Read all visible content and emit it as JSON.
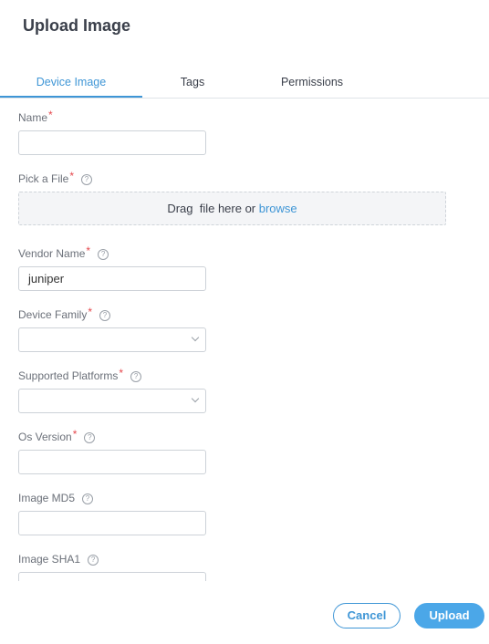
{
  "dialog": {
    "title": "Upload Image"
  },
  "tabs": [
    {
      "label": "Device Image",
      "active": true
    },
    {
      "label": "Tags",
      "active": false
    },
    {
      "label": "Permissions",
      "active": false
    }
  ],
  "fields": {
    "name": {
      "label": "Name",
      "required_mark": "*",
      "value": ""
    },
    "file": {
      "label": "Pick a File",
      "required_mark": "*",
      "help": "?",
      "drop_text": "Drag  file here or ",
      "browse_link": "browse"
    },
    "vendor": {
      "label": "Vendor Name",
      "required_mark": "*",
      "help": "?",
      "value": "juniper"
    },
    "device_family": {
      "label": "Device Family",
      "required_mark": "*",
      "help": "?",
      "value": ""
    },
    "supported_platforms": {
      "label": "Supported Platforms",
      "required_mark": "*",
      "help": "?",
      "value": ""
    },
    "os_version": {
      "label": "Os Version",
      "required_mark": "*",
      "help": "?",
      "value": ""
    },
    "image_md5": {
      "label": "Image MD5",
      "help": "?",
      "value": ""
    },
    "image_sha1": {
      "label": "Image SHA1",
      "help": "?",
      "value": ""
    }
  },
  "buttons": {
    "cancel": "Cancel",
    "upload": "Upload"
  },
  "colors": {
    "accent": "#3f96d6",
    "primary_button": "#4ba7e8",
    "required": "#e5484d"
  }
}
